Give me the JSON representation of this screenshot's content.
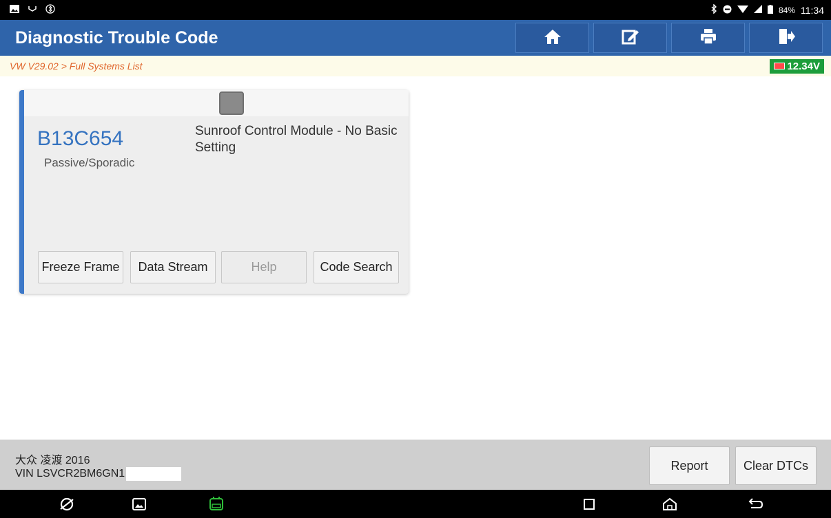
{
  "status_bar": {
    "battery_percent": "84%",
    "time": "11:34"
  },
  "header": {
    "title": "Diagnostic Trouble Code",
    "buttons": [
      "home-icon",
      "edit-icon",
      "print-icon",
      "exit-icon"
    ]
  },
  "breadcrumb": {
    "path": "VW V29.02 > Full Systems List",
    "voltage": "12.34V"
  },
  "dtc": {
    "code": "B13C654",
    "status": "Passive/Sporadic",
    "description": "Sunroof Control Module - No Basic Setting",
    "buttons": {
      "freeze_frame": "Freeze Frame",
      "data_stream": "Data Stream",
      "help": "Help",
      "code_search": "Code Search"
    }
  },
  "footer": {
    "vehicle": "大众 凌渡 2016",
    "vin": "VIN LSVCR2BM6GN1",
    "report": "Report",
    "clear_dtcs": "Clear DTCs"
  },
  "colors": {
    "header_blue": "#2f64aa",
    "accent_blue": "#3c78c8",
    "breadcrumb_orange": "#e0652b",
    "voltage_green": "#1c9d3a"
  }
}
